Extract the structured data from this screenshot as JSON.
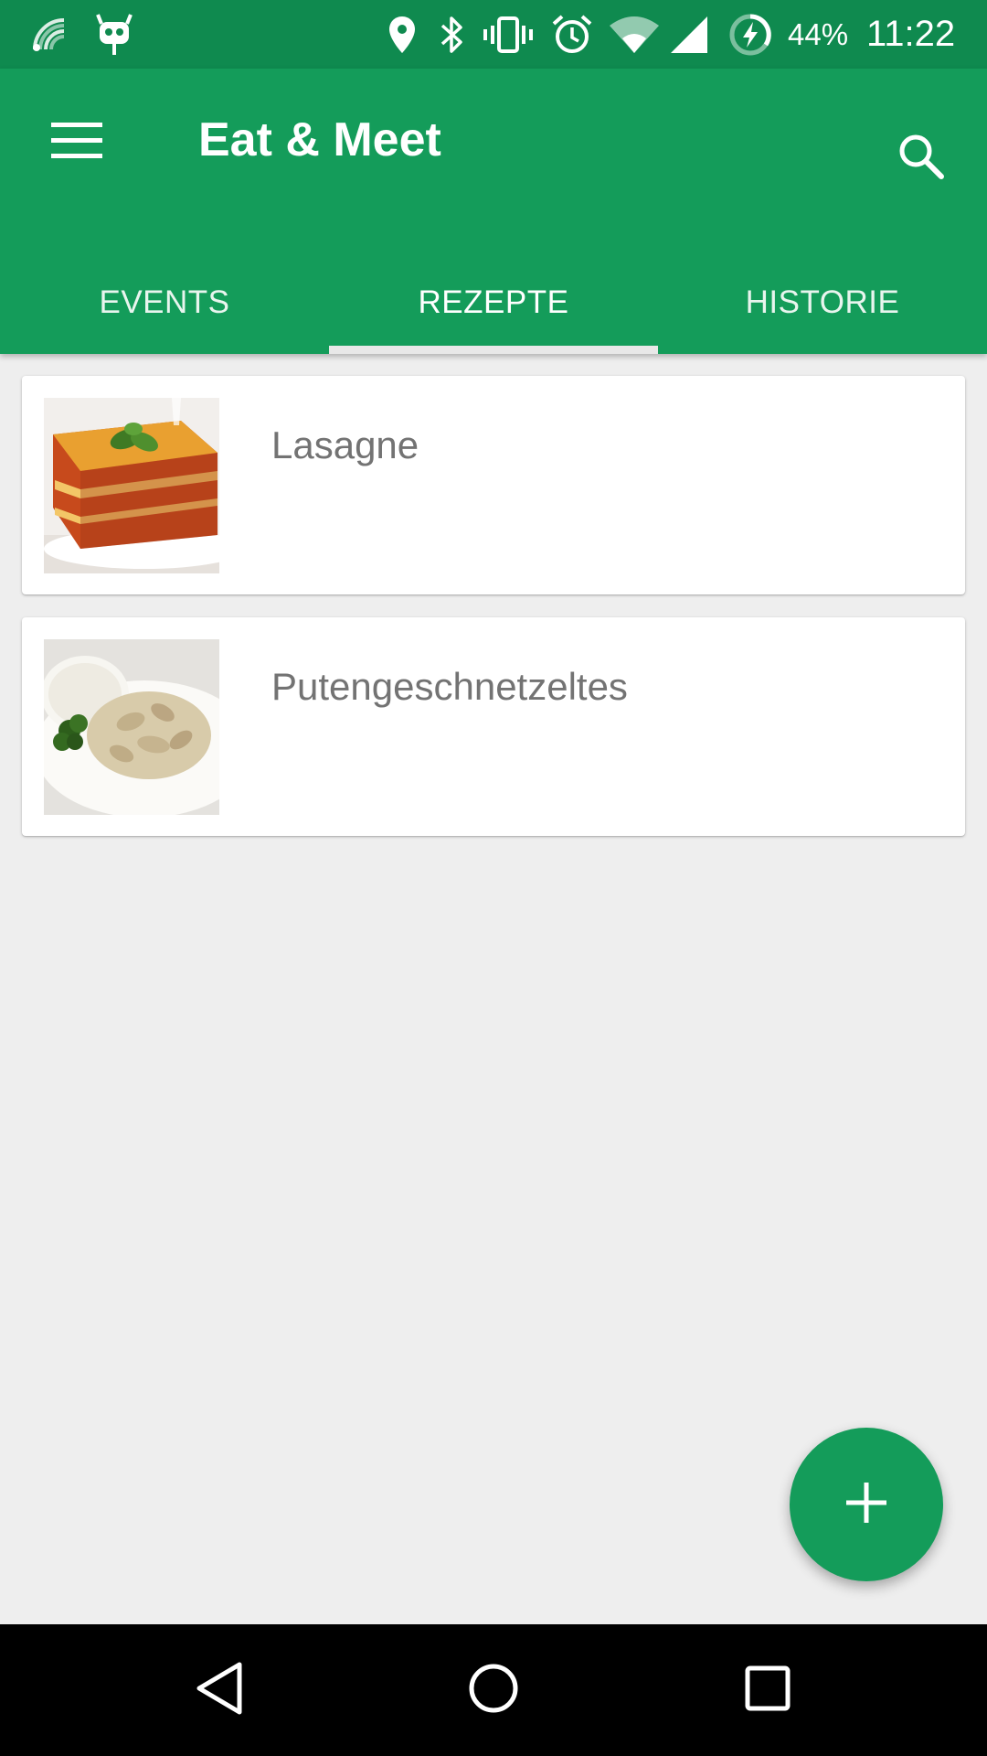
{
  "status_bar": {
    "battery": "44%",
    "time": "11:22",
    "icons": [
      "cast-signal-icon",
      "android-debug-icon",
      "location-icon",
      "bluetooth-icon",
      "vibrate-icon",
      "alarm-icon",
      "wifi-icon",
      "cell-signal-icon",
      "battery-charging-icon"
    ]
  },
  "app_bar": {
    "title": "Eat & Meet",
    "menu_icon": "hamburger-menu-icon",
    "search_icon": "search-icon",
    "color": "#149c5a"
  },
  "tabs": [
    {
      "label": "EVENTS",
      "selected": false
    },
    {
      "label": "REZEPTE",
      "selected": true
    },
    {
      "label": "HISTORIE",
      "selected": false
    }
  ],
  "recipes": [
    {
      "name": "Lasagne"
    },
    {
      "name": "Putengeschnetzeltes"
    }
  ],
  "fab": {
    "icon": "plus-icon"
  },
  "nav_bar": {
    "icons": [
      "back-icon",
      "home-icon",
      "recents-icon"
    ]
  }
}
